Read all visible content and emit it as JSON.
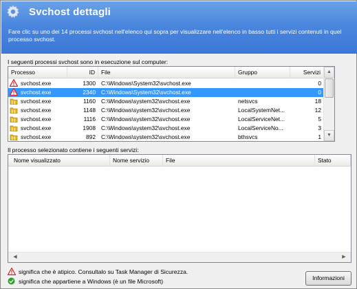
{
  "banner": {
    "title": "Svchost dettagli",
    "description": "Fare clic su uno dei 14 processi svchost nell'elenco qui sopra per visualizzare nell'elenco in basso tutti i servizi contenuti in quel processo svchost."
  },
  "processes": {
    "caption": "I seguenti processi svchost sono in esecuzione sul computer:",
    "columns": {
      "processo": "Processo",
      "id": "ID",
      "file": "File",
      "gruppo": "Gruppo",
      "servizi": "Servizi"
    },
    "rows": [
      {
        "icon": "warning-icon",
        "processo": "svchost.exe",
        "id": "1300",
        "file": "C:\\Windows\\System32\\svchost.exe",
        "gruppo": "",
        "servizi": "0"
      },
      {
        "icon": "warning-icon",
        "processo": "svchost.exe",
        "id": "2340",
        "file": "C:\\Windows\\System32\\svchost.exe",
        "gruppo": "",
        "servizi": "0"
      },
      {
        "icon": "folder-icon",
        "processo": "svchost.exe",
        "id": "1160",
        "file": "C:\\Windows\\system32\\svchost.exe",
        "gruppo": "netsvcs",
        "servizi": "18"
      },
      {
        "icon": "folder-icon",
        "processo": "svchost.exe",
        "id": "1148",
        "file": "C:\\Windows\\system32\\svchost.exe",
        "gruppo": "LocalSystemNet...",
        "servizi": "12"
      },
      {
        "icon": "folder-icon",
        "processo": "svchost.exe",
        "id": "1116",
        "file": "C:\\Windows\\system32\\svchost.exe",
        "gruppo": "LocalServiceNet...",
        "servizi": "5"
      },
      {
        "icon": "folder-icon",
        "processo": "svchost.exe",
        "id": "1908",
        "file": "C:\\Windows\\system32\\svchost.exe",
        "gruppo": "LocalServiceNo...",
        "servizi": "3"
      },
      {
        "icon": "folder-icon",
        "processo": "svchost.exe",
        "id": "892",
        "file": "C:\\Windows\\system32\\svchost.exe",
        "gruppo": "bthsvcs",
        "servizi": "1"
      }
    ],
    "selected_index": 1
  },
  "services": {
    "caption": "Il processo selezionato contiene i seguenti servizi:",
    "columns": {
      "nome_visualizzato": "Nome visualizzato",
      "nome_servizio": "Nome servizio",
      "file": "File",
      "stato": "Stato"
    }
  },
  "legend": {
    "warning_text": "significa che è atipico. Consultalo su Task Manager di Sicurezza.",
    "windows_text": "significa che appartiene a Windows (è un file Microsoft)"
  },
  "buttons": {
    "info": "Informazioni"
  },
  "colors": {
    "banner": "#4a86dd",
    "selection": "#3399ff",
    "warning": "#d42020",
    "ok": "#2e9e2e"
  }
}
